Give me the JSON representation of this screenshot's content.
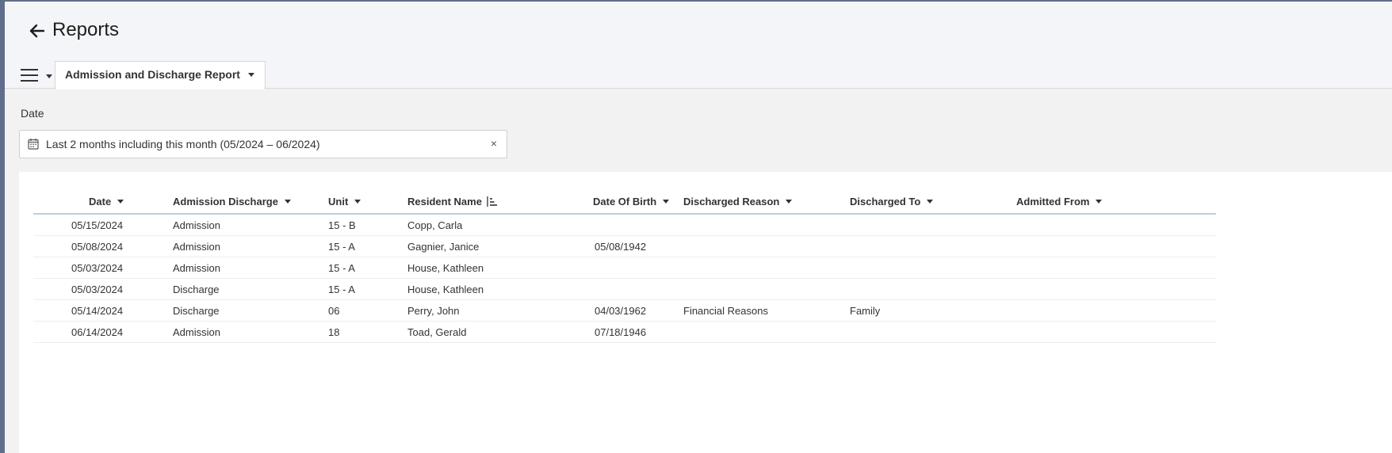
{
  "header": {
    "title": "Reports",
    "back_icon": "arrow-left-icon"
  },
  "tabs": {
    "menu_icon": "hamburger-menu-icon",
    "active_report": "Admission and Discharge Report"
  },
  "filters": {
    "date_label": "Date",
    "date_value": "Last 2 months including this month (05/2024 – 06/2024)",
    "clear_label": "×"
  },
  "grid": {
    "columns": [
      {
        "key": "date",
        "label": "Date"
      },
      {
        "key": "admission_discharge",
        "label": "Admission Discharge"
      },
      {
        "key": "unit",
        "label": "Unit"
      },
      {
        "key": "resident_name",
        "label": "Resident Name"
      },
      {
        "key": "date_of_birth",
        "label": "Date Of Birth"
      },
      {
        "key": "discharged_reason",
        "label": "Discharged Reason"
      },
      {
        "key": "discharged_to",
        "label": "Discharged To"
      },
      {
        "key": "admitted_from",
        "label": "Admitted From"
      }
    ],
    "rows": [
      {
        "date": "05/15/2024",
        "admission_discharge": "Admission",
        "unit": "15 - B",
        "resident_name": "Copp, Carla",
        "date_of_birth": "",
        "discharged_reason": "",
        "discharged_to": "",
        "admitted_from": ""
      },
      {
        "date": "05/08/2024",
        "admission_discharge": "Admission",
        "unit": "15 - A",
        "resident_name": "Gagnier, Janice",
        "date_of_birth": "05/08/1942",
        "discharged_reason": "",
        "discharged_to": "",
        "admitted_from": ""
      },
      {
        "date": "05/03/2024",
        "admission_discharge": "Admission",
        "unit": "15 - A",
        "resident_name": "House, Kathleen",
        "date_of_birth": "",
        "discharged_reason": "",
        "discharged_to": "",
        "admitted_from": ""
      },
      {
        "date": "05/03/2024",
        "admission_discharge": "Discharge",
        "unit": "15 - A",
        "resident_name": "House, Kathleen",
        "date_of_birth": "",
        "discharged_reason": "",
        "discharged_to": "",
        "admitted_from": ""
      },
      {
        "date": "05/14/2024",
        "admission_discharge": "Discharge",
        "unit": "06",
        "resident_name": "Perry, John",
        "date_of_birth": "04/03/1962",
        "discharged_reason": "Financial Reasons",
        "discharged_to": "Family",
        "admitted_from": ""
      },
      {
        "date": "06/14/2024",
        "admission_discharge": "Admission",
        "unit": "18",
        "resident_name": "Toad, Gerald",
        "date_of_birth": "07/18/1946",
        "discharged_reason": "",
        "discharged_to": "",
        "admitted_from": ""
      }
    ]
  },
  "colors": {
    "header_bg": "#f4f5f9",
    "page_bg": "#f2f2f2",
    "rail": "#5f6e8a",
    "grid_header_border": "#b4d2df"
  }
}
